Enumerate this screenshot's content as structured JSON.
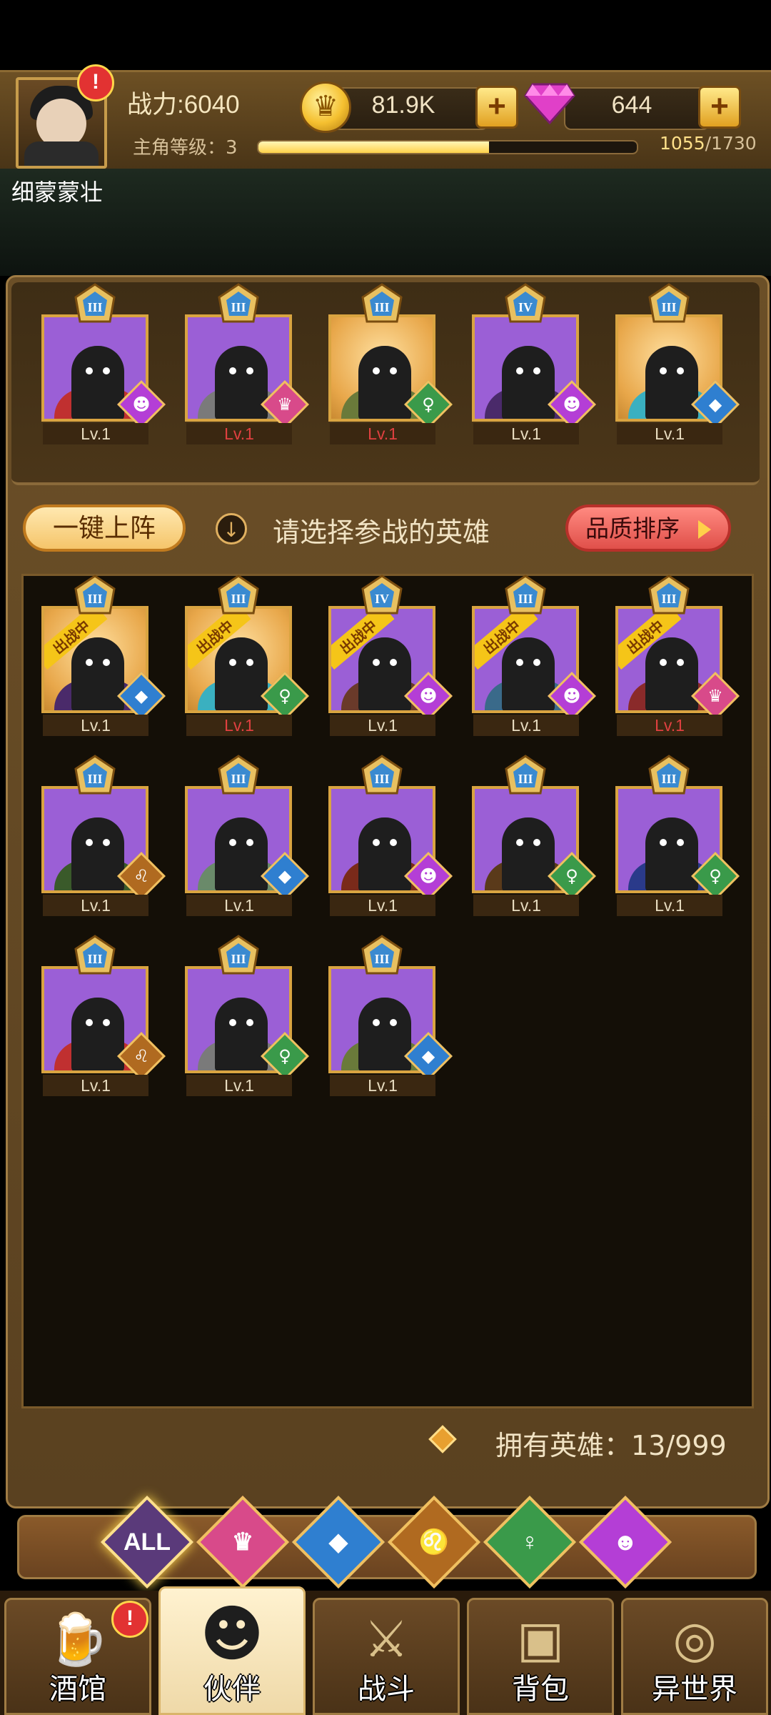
{
  "header": {
    "power": "战力:6040",
    "level_label": "主角等级：3",
    "xp_current": "1055",
    "xp_total": "/1730",
    "xp_progress": 0.61,
    "gold": "81.9K",
    "gems": "644",
    "alert": "!"
  },
  "player_name": "细蒙蒙壮",
  "team": [
    {
      "rank": "III",
      "lv": "Lv.1",
      "lv_red": false,
      "bg": "purple",
      "faction": "demon"
    },
    {
      "rank": "III",
      "lv": "Lv.1",
      "lv_red": true,
      "bg": "purple",
      "faction": "crown"
    },
    {
      "rank": "III",
      "lv": "Lv.1",
      "lv_red": true,
      "bg": "gold",
      "faction": "elf"
    },
    {
      "rank": "IV",
      "lv": "Lv.1",
      "lv_red": false,
      "bg": "purple",
      "faction": "demon"
    },
    {
      "rank": "III",
      "lv": "Lv.1",
      "lv_red": false,
      "bg": "gold",
      "faction": "fish"
    }
  ],
  "controls": {
    "deploy_label": "一键上阵",
    "hint_text": "请选择参战的英雄",
    "sort_label": "品质排序",
    "ongoing_tag": "出战中"
  },
  "roster": [
    {
      "rank": "III",
      "lv": "Lv.1",
      "lv_red": false,
      "bg": "gold",
      "faction": "fish",
      "ongoing": true
    },
    {
      "rank": "III",
      "lv": "Lv.1",
      "lv_red": true,
      "bg": "gold",
      "faction": "elf",
      "ongoing": true
    },
    {
      "rank": "IV",
      "lv": "Lv.1",
      "lv_red": false,
      "bg": "purple",
      "faction": "demon",
      "ongoing": true
    },
    {
      "rank": "III",
      "lv": "Lv.1",
      "lv_red": false,
      "bg": "purple",
      "faction": "demon",
      "ongoing": true
    },
    {
      "rank": "III",
      "lv": "Lv.1",
      "lv_red": true,
      "bg": "purple",
      "faction": "crown",
      "ongoing": true
    },
    {
      "rank": "III",
      "lv": "Lv.1",
      "lv_red": false,
      "bg": "purple",
      "faction": "lion",
      "ongoing": false
    },
    {
      "rank": "III",
      "lv": "Lv.1",
      "lv_red": false,
      "bg": "purple",
      "faction": "fish",
      "ongoing": false
    },
    {
      "rank": "III",
      "lv": "Lv.1",
      "lv_red": false,
      "bg": "purple",
      "faction": "demon",
      "ongoing": false
    },
    {
      "rank": "III",
      "lv": "Lv.1",
      "lv_red": false,
      "bg": "purple",
      "faction": "elf",
      "ongoing": false
    },
    {
      "rank": "III",
      "lv": "Lv.1",
      "lv_red": false,
      "bg": "purple",
      "faction": "elf",
      "ongoing": false
    },
    {
      "rank": "III",
      "lv": "Lv.1",
      "lv_red": false,
      "bg": "purple",
      "faction": "lion",
      "ongoing": false
    },
    {
      "rank": "III",
      "lv": "Lv.1",
      "lv_red": false,
      "bg": "purple",
      "faction": "elf",
      "ongoing": false
    },
    {
      "rank": "III",
      "lv": "Lv.1",
      "lv_red": false,
      "bg": "purple",
      "faction": "fish",
      "ongoing": false
    }
  ],
  "owned": "拥有英雄：13/999",
  "filters": [
    {
      "label": "ALL",
      "name": "all",
      "active": true
    },
    {
      "label": "",
      "name": "crown",
      "active": false
    },
    {
      "label": "",
      "name": "fish",
      "active": false
    },
    {
      "label": "",
      "name": "lion",
      "active": false
    },
    {
      "label": "",
      "name": "elf",
      "active": false
    },
    {
      "label": "",
      "name": "demon",
      "active": false
    }
  ],
  "nav": [
    {
      "label": "酒馆",
      "name": "tavern",
      "active": false,
      "alert": true
    },
    {
      "label": "伙伴",
      "name": "partner",
      "active": true,
      "alert": false
    },
    {
      "label": "战斗",
      "name": "battle",
      "active": false,
      "alert": false
    },
    {
      "label": "背包",
      "name": "bag",
      "active": false,
      "alert": false
    },
    {
      "label": "异世界",
      "name": "otherworld",
      "active": false,
      "alert": false
    }
  ],
  "colors": {
    "panel": "#5a4120",
    "card_purple": "#9b5fd6",
    "card_gold": "#e8a74a",
    "accent_gold": "#d9a441",
    "level_red": "#e04040",
    "xp_fill": "#ffd24a"
  }
}
